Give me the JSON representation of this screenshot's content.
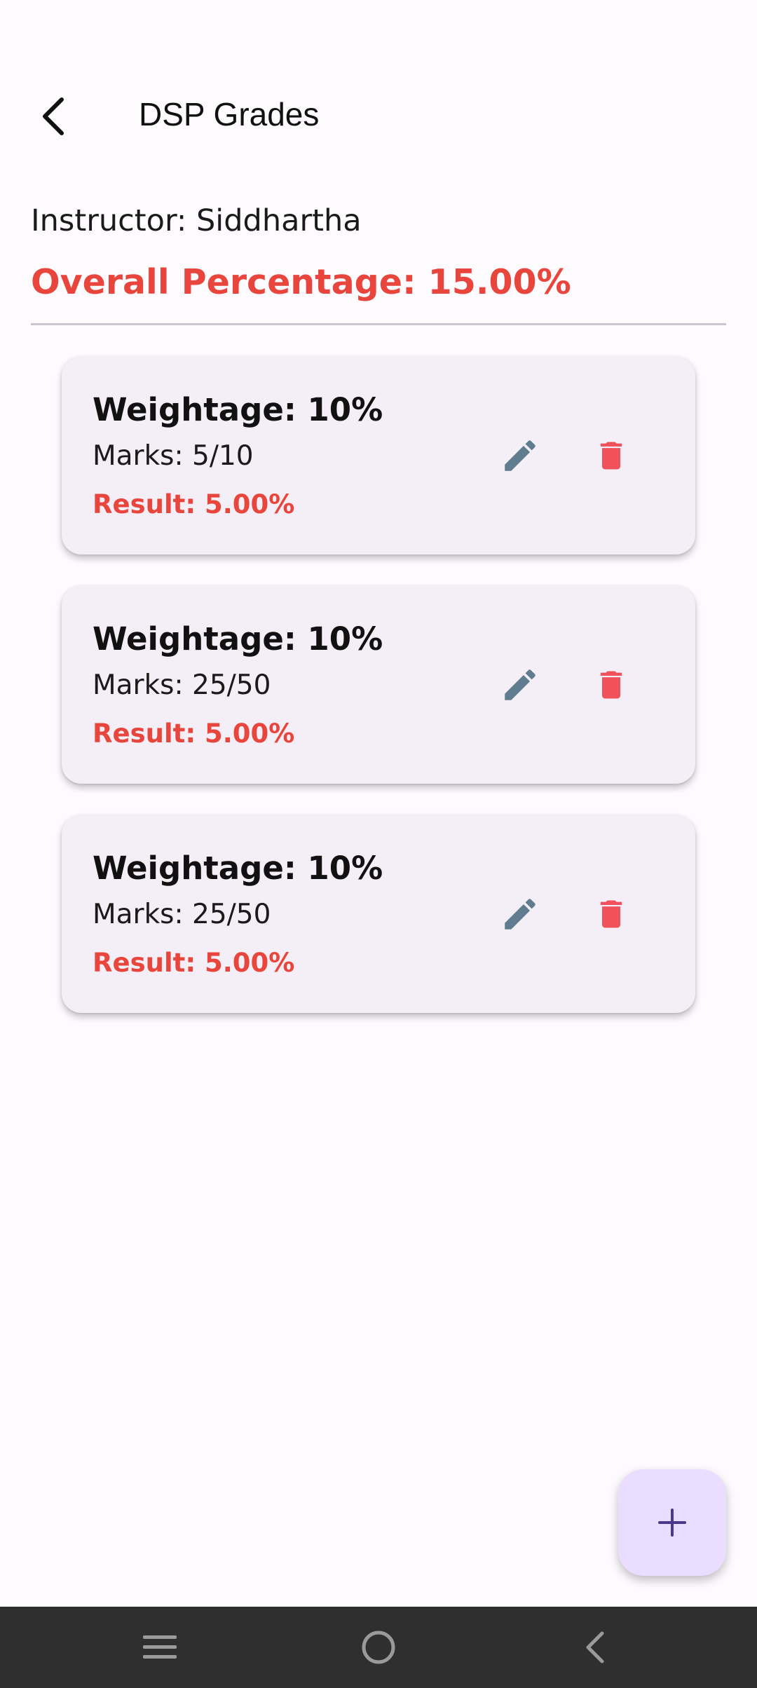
{
  "header": {
    "back_icon": "arrow-back-icon",
    "title": "DSP Grades"
  },
  "summary": {
    "instructor": "Instructor: Siddhartha",
    "overall": "Overall Percentage: 15.00%"
  },
  "grades": [
    {
      "weightage": "Weightage: 10%",
      "marks": "Marks: 5/10",
      "result": "Result: 5.00%"
    },
    {
      "weightage": "Weightage: 10%",
      "marks": "Marks: 25/50",
      "result": "Result: 5.00%"
    },
    {
      "weightage": "Weightage: 10%",
      "marks": "Marks: 25/50",
      "result": "Result: 5.00%"
    }
  ],
  "icons": {
    "edit": "pencil-icon",
    "delete": "trash-icon",
    "add": "plus-icon"
  },
  "colors": {
    "accent_red": "#e8453c",
    "edit_icon": "#5f7d8e",
    "delete_icon": "#f0515a",
    "fab_bg": "#eaddff",
    "fab_icon": "#4b3a8c",
    "card_bg": "#f4eff6",
    "nav_bg": "#2f2f2f"
  },
  "system_nav": {
    "items": [
      "menu-icon",
      "home-icon",
      "back-icon"
    ]
  }
}
